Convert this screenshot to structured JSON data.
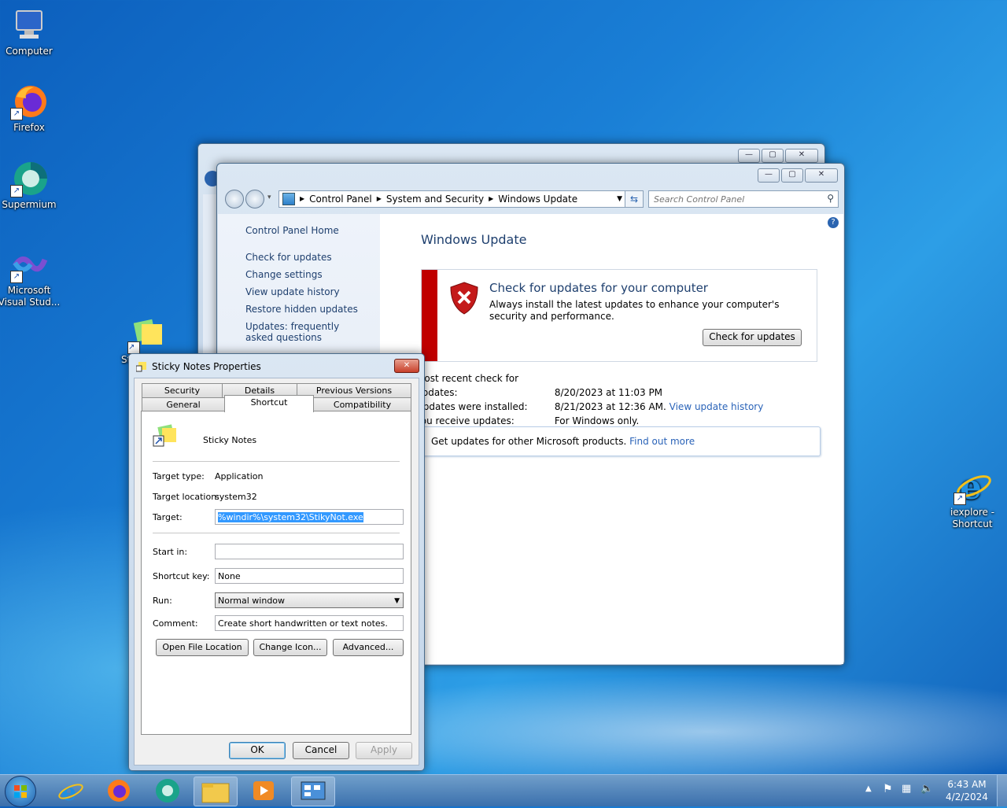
{
  "desktop": {
    "icons": [
      {
        "label": "Computer"
      },
      {
        "label": "Firefox"
      },
      {
        "label": "Supermium"
      },
      {
        "label": "Microsoft Visual Stud..."
      },
      {
        "label": "St"
      },
      {
        "label": "iexplore - Shortcut"
      }
    ]
  },
  "control_panel": {
    "breadcrumb": [
      "Control Panel",
      "System and Security",
      "Windows Update"
    ],
    "search_placeholder": "Search Control Panel",
    "left_links": [
      "Control Panel Home",
      "Check for updates",
      "Change settings",
      "View update history",
      "Restore hidden updates",
      "Updates: frequently asked questions"
    ],
    "title": "Windows Update",
    "alert": {
      "heading": "Check for updates for your computer",
      "body": "Always install the latest updates to enhance your computer's security and performance.",
      "button": "Check for updates",
      "color": "#c00000"
    },
    "info": [
      {
        "label": "Most recent check for updates:",
        "value": "8/20/2023 at 11:03 PM",
        "link": ""
      },
      {
        "label": "Updates were installed:",
        "value": "8/21/2023 at 12:36 AM.",
        "link": "View update history"
      },
      {
        "label": "You receive updates:",
        "value": "For Windows only.",
        "link": ""
      }
    ],
    "other_products": {
      "text": "Get updates for other Microsoft products.",
      "link": "Find out more"
    }
  },
  "properties": {
    "title": "Sticky Notes Properties",
    "tabs_row1": [
      "Security",
      "Details",
      "Previous Versions"
    ],
    "tabs_row2": [
      "General",
      "Shortcut",
      "Compatibility"
    ],
    "name": "Sticky Notes",
    "target_type_label": "Target type:",
    "target_type": "Application",
    "target_location_label": "Target location:",
    "target_location": "system32",
    "target_label": "Target:",
    "target": "%windir%\\system32\\StikyNot.exe",
    "start_in_label": "Start in:",
    "start_in": "",
    "shortcut_key_label": "Shortcut key:",
    "shortcut_key": "None",
    "run_label": "Run:",
    "run": "Normal window",
    "comment_label": "Comment:",
    "comment": "Create short handwritten or text notes.",
    "buttons": {
      "open_location": "Open File Location",
      "change_icon": "Change Icon...",
      "advanced": "Advanced...",
      "ok": "OK",
      "cancel": "Cancel",
      "apply": "Apply"
    }
  },
  "taskbar": {
    "time": "6:43 AM",
    "date": "4/2/2024"
  }
}
